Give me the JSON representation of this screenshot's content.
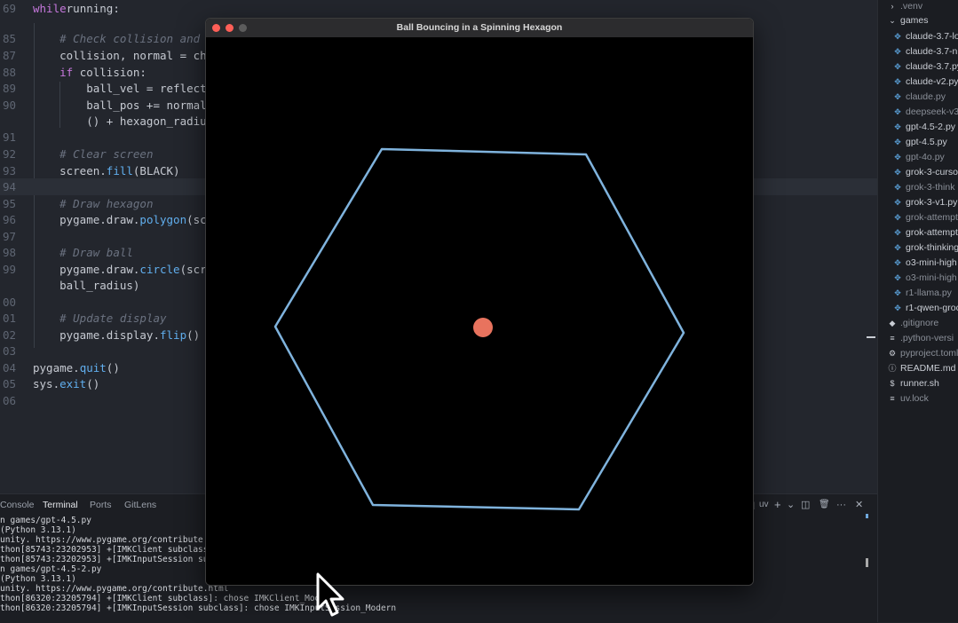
{
  "editor": {
    "lines": [
      {
        "num": "69",
        "tokens": [
          [
            "kw",
            "while"
          ],
          [
            "",
            "running:"
          ]
        ]
      },
      {
        "num": "85",
        "tokens": [
          [
            "",
            "    "
          ],
          [
            "cm",
            "# Check collision and"
          ]
        ]
      },
      {
        "num": "87",
        "tokens": [
          [
            "",
            "    collision, normal = ch"
          ]
        ]
      },
      {
        "num": "88",
        "tokens": [
          [
            "",
            "    "
          ],
          [
            "kw",
            "if"
          ],
          [
            "",
            " collision:"
          ]
        ]
      },
      {
        "num": "89",
        "tokens": [
          [
            "",
            "        ball_vel = reflect"
          ]
        ]
      },
      {
        "num": "90",
        "tokens": [
          [
            "",
            "        ball_pos += normal"
          ]
        ]
      },
      {
        "num": "",
        "tokens": [
          [
            "",
            "        () + hexagon_radiu"
          ]
        ]
      },
      {
        "num": "91",
        "tokens": [
          [
            "",
            ""
          ]
        ]
      },
      {
        "num": "92",
        "tokens": [
          [
            "",
            "    "
          ],
          [
            "cm",
            "# Clear screen"
          ]
        ]
      },
      {
        "num": "93",
        "tokens": [
          [
            "",
            "    screen."
          ],
          [
            "fn",
            "fill"
          ],
          [
            "",
            "(BLACK)"
          ]
        ]
      },
      {
        "num": "94",
        "tokens": [
          [
            "",
            ""
          ]
        ]
      },
      {
        "num": "95",
        "tokens": [
          [
            "",
            "    "
          ],
          [
            "cm",
            "# Draw hexagon"
          ]
        ]
      },
      {
        "num": "96",
        "tokens": [
          [
            "",
            "    pygame.draw."
          ],
          [
            "fn",
            "polygon"
          ],
          [
            "",
            "(sc"
          ]
        ]
      },
      {
        "num": "97",
        "tokens": [
          [
            "",
            ""
          ]
        ]
      },
      {
        "num": "98",
        "tokens": [
          [
            "",
            "    "
          ],
          [
            "cm",
            "# Draw ball"
          ]
        ]
      },
      {
        "num": "99",
        "tokens": [
          [
            "",
            "    pygame.draw."
          ],
          [
            "fn",
            "circle"
          ],
          [
            "",
            "(scr"
          ]
        ]
      },
      {
        "num": "",
        "tokens": [
          [
            "",
            "    ball_radius)"
          ]
        ]
      },
      {
        "num": "00",
        "tokens": [
          [
            "",
            ""
          ]
        ]
      },
      {
        "num": "01",
        "tokens": [
          [
            "",
            "    "
          ],
          [
            "cm",
            "# Update display"
          ]
        ]
      },
      {
        "num": "02",
        "tokens": [
          [
            "",
            "    pygame.display."
          ],
          [
            "fn",
            "flip"
          ],
          [
            "",
            "()"
          ]
        ]
      },
      {
        "num": "03",
        "tokens": [
          [
            "",
            ""
          ]
        ]
      },
      {
        "num": "04",
        "tokens": [
          [
            "",
            "pygame."
          ],
          [
            "fn",
            "quit"
          ],
          [
            "",
            "()"
          ]
        ]
      },
      {
        "num": "05",
        "tokens": [
          [
            "",
            "sys."
          ],
          [
            "fn",
            "exit"
          ],
          [
            "",
            "()"
          ]
        ]
      },
      {
        "num": "06",
        "tokens": [
          [
            "",
            ""
          ]
        ]
      }
    ]
  },
  "sidebar": {
    "items": [
      {
        "label": ".venv",
        "icon": "chevron-right-icon",
        "glyph": "›",
        "kind": "folder-dim"
      },
      {
        "label": "games",
        "icon": "chevron-down-icon",
        "glyph": "⌄",
        "kind": "folder"
      },
      {
        "label": "claude-3.7-lo",
        "icon": "python-file-icon",
        "glyph": "✥",
        "kind": "py"
      },
      {
        "label": "claude-3.7-n",
        "icon": "python-file-icon",
        "glyph": "✥",
        "kind": "py"
      },
      {
        "label": "claude-3.7.py",
        "icon": "python-file-icon",
        "glyph": "✥",
        "kind": "py"
      },
      {
        "label": "claude-v2.py",
        "icon": "python-file-icon",
        "glyph": "✥",
        "kind": "py"
      },
      {
        "label": "claude.py",
        "icon": "python-file-icon",
        "glyph": "✥",
        "kind": "py-dim"
      },
      {
        "label": "deepseek-v3",
        "icon": "python-file-icon",
        "glyph": "✥",
        "kind": "py-dim"
      },
      {
        "label": "gpt-4.5-2.py",
        "icon": "python-file-icon",
        "glyph": "✥",
        "kind": "py"
      },
      {
        "label": "gpt-4.5.py",
        "icon": "python-file-icon",
        "glyph": "✥",
        "kind": "py"
      },
      {
        "label": "gpt-4o.py",
        "icon": "python-file-icon",
        "glyph": "✥",
        "kind": "py-dim"
      },
      {
        "label": "grok-3-curso",
        "icon": "python-file-icon",
        "glyph": "✥",
        "kind": "py"
      },
      {
        "label": "grok-3-think",
        "icon": "python-file-icon",
        "glyph": "✥",
        "kind": "py-dim"
      },
      {
        "label": "grok-3-v1.py",
        "icon": "python-file-icon",
        "glyph": "✥",
        "kind": "py"
      },
      {
        "label": "grok-attempt",
        "icon": "python-file-icon",
        "glyph": "✥",
        "kind": "py-dim"
      },
      {
        "label": "grok-attempt",
        "icon": "python-file-icon",
        "glyph": "✥",
        "kind": "py"
      },
      {
        "label": "grok-thinking",
        "icon": "python-file-icon",
        "glyph": "✥",
        "kind": "py"
      },
      {
        "label": "o3-mini-high",
        "icon": "python-file-icon",
        "glyph": "✥",
        "kind": "py"
      },
      {
        "label": "o3-mini-high",
        "icon": "python-file-icon",
        "glyph": "✥",
        "kind": "py-dim"
      },
      {
        "label": "r1-llama.py",
        "icon": "python-file-icon",
        "glyph": "✥",
        "kind": "py-dim"
      },
      {
        "label": "r1-qwen-groc",
        "icon": "python-file-icon",
        "glyph": "✥",
        "kind": "py"
      },
      {
        "label": ".gitignore",
        "icon": "git-icon",
        "glyph": "◆",
        "kind": "root-dim"
      },
      {
        "label": ".python-versi",
        "icon": "lines-icon",
        "glyph": "≡",
        "kind": "root-dim"
      },
      {
        "label": "pyproject.toml",
        "icon": "gear-icon",
        "glyph": "⚙",
        "kind": "root-dim"
      },
      {
        "label": "README.md",
        "icon": "info-icon",
        "glyph": "ⓘ",
        "kind": "root"
      },
      {
        "label": "runner.sh",
        "icon": "dollar-icon",
        "glyph": "$",
        "kind": "root"
      },
      {
        "label": "uv.lock",
        "icon": "lines-icon",
        "glyph": "≡",
        "kind": "root-dim"
      }
    ]
  },
  "panel": {
    "tabs": [
      "Console",
      "Terminal",
      "Ports",
      "GitLens"
    ],
    "active_tab": "Terminal",
    "shell_label": "uv",
    "icons": {
      "add": "+",
      "chevron": "⌄",
      "split": "◫",
      "trash": "🗑",
      "more": "···",
      "close": "✕"
    },
    "lines": [
      "n games/gpt-4.5.py",
      "(Python 3.13.1)",
      "unity. https://www.pygame.org/contribute.htm",
      "thon[85743:23202953] +[IMKClient subclass]",
      "thon[85743:23202953] +[IMKInputSession subc",
      "n games/gpt-4.5-2.py",
      "(Python 3.13.1)",
      "unity. https://www.pygame.org/contribute.html",
      "thon[86320:23205794] +[IMKClient subclass]: chose IMKClient_Modern",
      "thon[86320:23205794] +[IMKInputSession subclass]: chose IMKInputSession_Modern"
    ]
  },
  "game_window": {
    "title": "Ball Bouncing in a Spinning Hexagon",
    "traffic_colors": [
      "#ff5f57",
      "#ff5f57",
      "#5c5c5c"
    ],
    "background": "#000000",
    "hexagon_color": "#7fb3dd",
    "ball_color": "#e8735e"
  }
}
